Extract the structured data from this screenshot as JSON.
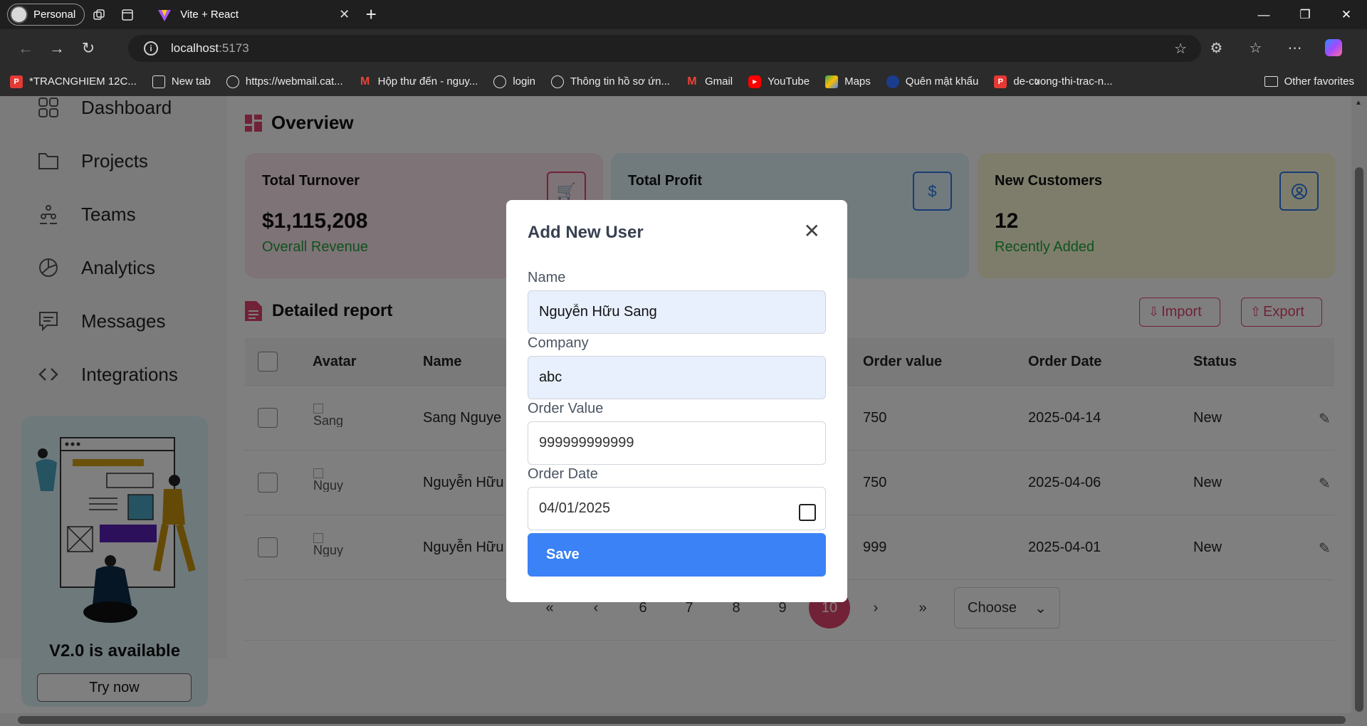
{
  "browser": {
    "profile_label": "Personal",
    "tab_title": "Vite + React",
    "address_host": "localhost",
    "address_port": ":5173",
    "bookmarks": [
      {
        "label": "*TRACNGHIEM 12C...",
        "icon": "pdf-icon"
      },
      {
        "label": "New tab",
        "icon": "doc-icon"
      },
      {
        "label": "https://webmail.cat...",
        "icon": "globe-icon"
      },
      {
        "label": "Hộp thư đến - nguy...",
        "icon": "gmail-icon"
      },
      {
        "label": "login",
        "icon": "globe-icon"
      },
      {
        "label": "Thông tin hồ sơ ứn...",
        "icon": "globe-icon"
      },
      {
        "label": "Gmail",
        "icon": "gmail-icon"
      },
      {
        "label": "YouTube",
        "icon": "youtube-icon"
      },
      {
        "label": "Maps",
        "icon": "maps-icon"
      },
      {
        "label": "Quên mật khẩu",
        "icon": "shield-icon"
      },
      {
        "label": "de-cuong-thi-trac-n...",
        "icon": "pdf-icon"
      }
    ],
    "other_favorites": "Other favorites"
  },
  "sidebar": {
    "items": [
      {
        "label": "Dashboard",
        "icon": "grid-icon"
      },
      {
        "label": "Projects",
        "icon": "folder-icon"
      },
      {
        "label": "Teams",
        "icon": "team-icon"
      },
      {
        "label": "Analytics",
        "icon": "pie-chart-icon"
      },
      {
        "label": "Messages",
        "icon": "message-icon"
      },
      {
        "label": "Integrations",
        "icon": "code-icon"
      }
    ],
    "promo_title": "V2.0 is available",
    "promo_button": "Try now"
  },
  "overview": {
    "title": "Overview",
    "cards": [
      {
        "title": "Total Turnover",
        "value": "$1,115,208",
        "sub": "Overall Revenue",
        "icon": "cart-icon"
      },
      {
        "title": "Total Profit",
        "value": "",
        "sub": "",
        "icon": "dollar-icon"
      },
      {
        "title": "New Customers",
        "value": "12",
        "sub": "Recently Added",
        "icon": "user-icon"
      }
    ]
  },
  "report": {
    "title": "Detailed report",
    "import_label": "Import",
    "export_label": "Export",
    "columns": [
      "Avatar",
      "Name",
      "Order value",
      "Order Date",
      "Status"
    ],
    "rows": [
      {
        "avatar_alt": "Sang",
        "name": "Sang Nguye",
        "order_value": "750",
        "order_date": "2025-04-14",
        "status": "New"
      },
      {
        "avatar_alt": "Nguy",
        "name": "Nguyễn Hữu",
        "order_value": "750",
        "order_date": "2025-04-06",
        "status": "New"
      },
      {
        "avatar_alt": "Nguy",
        "name": "Nguyễn Hữu",
        "order_value": "999",
        "order_date": "2025-04-01",
        "status": "New"
      }
    ],
    "pagination": {
      "first": "«",
      "prev": "‹",
      "pages": [
        "6",
        "7",
        "8",
        "9",
        "10"
      ],
      "active_page": "10",
      "next": "›",
      "last": "»",
      "choose_label": "Choose"
    }
  },
  "modal": {
    "title": "Add New User",
    "name_label": "Name",
    "name_value": "Nguyễn Hữu Sang",
    "company_label": "Company",
    "company_value": "abc",
    "order_value_label": "Order Value",
    "order_value_value": "999999999999",
    "order_date_label": "Order Date",
    "order_date_value": "04/01/2025",
    "save_label": "Save"
  },
  "colors": {
    "accent_pink": "#e2446e",
    "accent_blue": "#3b82f6",
    "success_green": "#1fa53a"
  }
}
